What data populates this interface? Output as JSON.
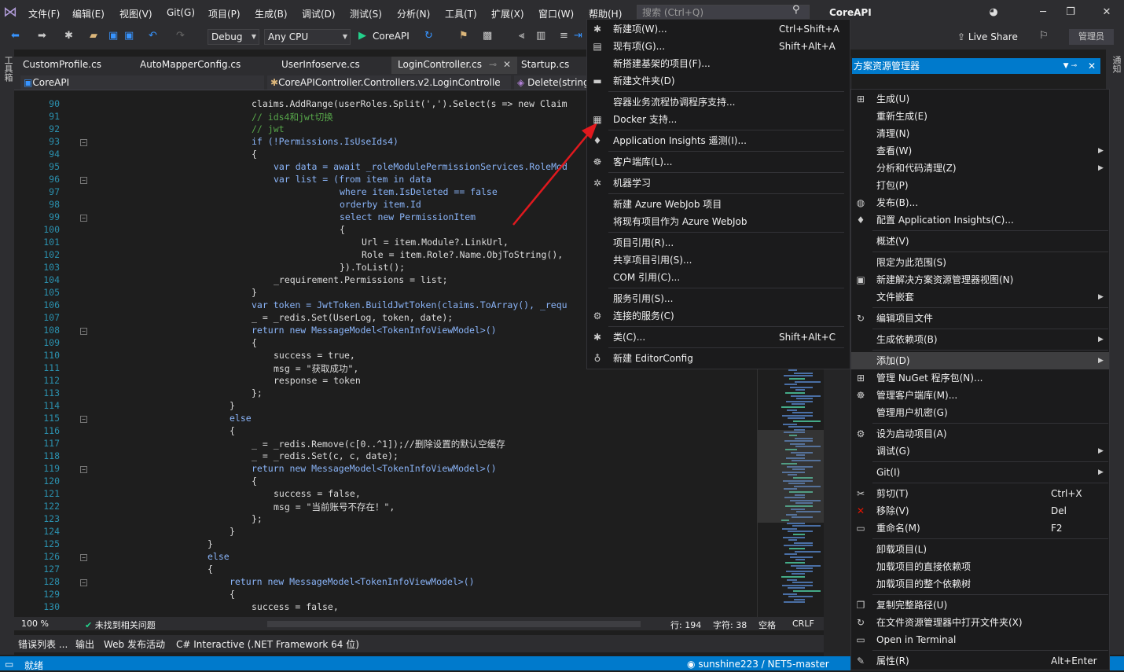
{
  "menubar": {
    "items": [
      "文件(F)",
      "编辑(E)",
      "视图(V)",
      "Git(G)",
      "项目(P)",
      "生成(B)",
      "调试(D)",
      "测试(S)",
      "分析(N)",
      "工具(T)",
      "扩展(X)",
      "窗口(W)",
      "帮助(H)"
    ],
    "search_placeholder": "搜索 (Ctrl+Q)",
    "title": "CoreAPI"
  },
  "toolbar": {
    "config": "Debug",
    "platform": "Any CPU",
    "run_target": "CoreAPI",
    "live_share": "Live Share",
    "admin": "管理员"
  },
  "tabs": [
    "CustomProfile.cs",
    "AutoMapperConfig.cs",
    "UserInfoserve.cs",
    "LoginController.cs",
    "Startup.cs"
  ],
  "nav": {
    "project": "CoreAPI",
    "class": "CoreAPIController.Controllers.v2.LoginControlle",
    "method": "Delete(string"
  },
  "left_tool": "工具箱",
  "right_tool": "通知",
  "code_lines": [
    {
      "n": "90",
      "indent": 320,
      "t": "claims.AddRange(userRoles.Split(',').Select(s => new Claim"
    },
    {
      "n": "91",
      "indent": 320,
      "t": "// ids4和jwt切换",
      "c": "cm"
    },
    {
      "n": "92",
      "indent": 320,
      "t": "// jwt",
      "c": "cm"
    },
    {
      "n": "93",
      "indent": 320,
      "t": "if (!Permissions.IsUseIds4)",
      "fold": true
    },
    {
      "n": "94",
      "indent": 320,
      "t": "{"
    },
    {
      "n": "95",
      "indent": 348,
      "t": "var data = await _roleModulePermissionServices.RoleMod"
    },
    {
      "n": "96",
      "indent": 348,
      "t": "var list = (from item in data",
      "fold": true
    },
    {
      "n": "97",
      "indent": 432,
      "t": "where item.IsDeleted == false"
    },
    {
      "n": "98",
      "indent": 432,
      "t": "orderby item.Id"
    },
    {
      "n": "99",
      "indent": 432,
      "t": "select new PermissionItem",
      "fold": true
    },
    {
      "n": "100",
      "indent": 432,
      "t": "{"
    },
    {
      "n": "101",
      "indent": 460,
      "t": "Url = item.Module?.LinkUrl,"
    },
    {
      "n": "102",
      "indent": 460,
      "t": "Role = item.Role?.Name.ObjToString(),"
    },
    {
      "n": "103",
      "indent": 432,
      "t": "}).ToList();"
    },
    {
      "n": "104",
      "indent": 348,
      "t": "_requirement.Permissions = list;"
    },
    {
      "n": "105",
      "indent": 320,
      "t": "}"
    },
    {
      "n": "106",
      "indent": 320,
      "t": "var token = JwtToken.BuildJwtToken(claims.ToArray(), _requ"
    },
    {
      "n": "107",
      "indent": 320,
      "t": "_ = _redis.Set(UserLog, token, date);"
    },
    {
      "n": "108",
      "indent": 320,
      "t": "return new MessageModel<TokenInfoViewModel>()",
      "fold": true
    },
    {
      "n": "109",
      "indent": 320,
      "t": "{"
    },
    {
      "n": "110",
      "indent": 348,
      "t": "success = true,"
    },
    {
      "n": "111",
      "indent": 348,
      "t": "msg = \"获取成功\","
    },
    {
      "n": "112",
      "indent": 348,
      "t": "response = token"
    },
    {
      "n": "113",
      "indent": 320,
      "t": "};"
    },
    {
      "n": "114",
      "indent": 292,
      "t": "}"
    },
    {
      "n": "115",
      "indent": 292,
      "t": "else",
      "fold": true
    },
    {
      "n": "116",
      "indent": 292,
      "t": "{"
    },
    {
      "n": "117",
      "indent": 320,
      "t": "_ = _redis.Remove(c[0..^1]);//删除设置的默认空缓存"
    },
    {
      "n": "118",
      "indent": 320,
      "t": "_ = _redis.Set(c, c, date);"
    },
    {
      "n": "119",
      "indent": 320,
      "t": "return new MessageModel<TokenInfoViewModel>()",
      "fold": true
    },
    {
      "n": "120",
      "indent": 320,
      "t": "{"
    },
    {
      "n": "121",
      "indent": 348,
      "t": "success = false,"
    },
    {
      "n": "122",
      "indent": 348,
      "t": "msg = \"当前账号不存在！\","
    },
    {
      "n": "123",
      "indent": 320,
      "t": "};"
    },
    {
      "n": "124",
      "indent": 292,
      "t": "}"
    },
    {
      "n": "125",
      "indent": 264,
      "t": "}"
    },
    {
      "n": "126",
      "indent": 264,
      "t": "else",
      "fold": true
    },
    {
      "n": "127",
      "indent": 264,
      "t": "{"
    },
    {
      "n": "128",
      "indent": 292,
      "t": "return new MessageModel<TokenInfoViewModel>()",
      "fold": true
    },
    {
      "n": "129",
      "indent": 292,
      "t": "{"
    },
    {
      "n": "130",
      "indent": 320,
      "t": "success = false,"
    }
  ],
  "editor_status": {
    "zoom": "100 %",
    "issues": "未找到相关问题",
    "line": "行: 194",
    "char": "字符: 38",
    "space": "空格",
    "eol": "CRLF"
  },
  "bottom_tabs": [
    "错误列表 ...",
    "输出",
    "Web 发布活动",
    "C# Interactive (.NET Framework 64 位)"
  ],
  "statusbar": {
    "ready": "就绪",
    "branch": "sunshine223 / NET5-master"
  },
  "solution_explorer": {
    "title": "方案资源管理器"
  },
  "add_menu": [
    {
      "label": "新建项(W)...",
      "shortcut": "Ctrl+Shift+A",
      "icon": "new-item-icon",
      "glyph": "✱"
    },
    {
      "label": "现有项(G)...",
      "shortcut": "Shift+Alt+A",
      "icon": "existing-item-icon",
      "glyph": "▤"
    },
    {
      "label": "新搭建基架的项目(F)..."
    },
    {
      "label": "新建文件夹(D)",
      "icon": "folder-icon",
      "glyph": "▬"
    },
    {
      "sep": true
    },
    {
      "label": "容器业务流程协调程序支持..."
    },
    {
      "label": "Docker 支持...",
      "icon": "docker-icon",
      "glyph": "▦"
    },
    {
      "sep": true
    },
    {
      "label": "Application Insights 遥测(I)...",
      "icon": "insights-icon",
      "glyph": "♦"
    },
    {
      "sep": true
    },
    {
      "label": "客户端库(L)...",
      "icon": "client-library-icon",
      "glyph": "☸"
    },
    {
      "sep": true
    },
    {
      "label": "机器学习",
      "icon": "machine-learning-icon",
      "glyph": "✲"
    },
    {
      "sep": true
    },
    {
      "label": "新建 Azure WebJob 项目"
    },
    {
      "label": "将现有项目作为 Azure WebJob"
    },
    {
      "sep": true
    },
    {
      "label": "项目引用(R)..."
    },
    {
      "label": "共享项目引用(S)..."
    },
    {
      "label": "COM 引用(C)..."
    },
    {
      "sep": true
    },
    {
      "label": "服务引用(S)..."
    },
    {
      "label": "连接的服务(C)",
      "icon": "connected-service-icon",
      "glyph": "⚙"
    },
    {
      "sep": true
    },
    {
      "label": "类(C)...",
      "shortcut": "Shift+Alt+C",
      "icon": "class-icon",
      "glyph": "✱"
    },
    {
      "sep": true
    },
    {
      "label": "新建 EditorConfig",
      "icon": "editorconfig-icon",
      "glyph": "♁"
    }
  ],
  "ctx_menu": [
    {
      "label": "生成(U)",
      "icon": "build-icon",
      "glyph": "⊞"
    },
    {
      "label": "重新生成(E)"
    },
    {
      "label": "清理(N)"
    },
    {
      "label": "查看(W)",
      "sub": true
    },
    {
      "label": "分析和代码清理(Z)",
      "sub": true
    },
    {
      "label": "打包(P)"
    },
    {
      "label": "发布(B)...",
      "icon": "publish-icon",
      "glyph": "◍"
    },
    {
      "label": "配置 Application Insights(C)...",
      "icon": "insights-icon",
      "glyph": "♦"
    },
    {
      "sep": true
    },
    {
      "label": "概述(V)"
    },
    {
      "sep": true
    },
    {
      "label": "限定为此范围(S)"
    },
    {
      "label": "新建解决方案资源管理器视图(N)",
      "icon": "new-view-icon",
      "glyph": "▣"
    },
    {
      "label": "文件嵌套",
      "sub": true
    },
    {
      "sep": true
    },
    {
      "label": "编辑项目文件",
      "icon": "edit-project-icon",
      "glyph": "↻"
    },
    {
      "sep": true
    },
    {
      "label": "生成依赖项(B)",
      "sub": true
    },
    {
      "sep": true
    },
    {
      "label": "添加(D)",
      "sub": true,
      "hl": true
    },
    {
      "label": "管理 NuGet 程序包(N)...",
      "icon": "nuget-icon",
      "glyph": "⊞"
    },
    {
      "label": "管理客户端库(M)...",
      "icon": "client-library-icon",
      "glyph": "☸"
    },
    {
      "label": "管理用户机密(G)"
    },
    {
      "sep": true
    },
    {
      "label": "设为启动项目(A)",
      "icon": "gear-icon",
      "glyph": "⚙"
    },
    {
      "label": "调试(G)",
      "sub": true
    },
    {
      "sep": true
    },
    {
      "label": "Git(I)",
      "sub": true
    },
    {
      "sep": true
    },
    {
      "label": "剪切(T)",
      "shortcut": "Ctrl+X",
      "icon": "cut-icon",
      "glyph": "✂"
    },
    {
      "label": "移除(V)",
      "shortcut": "Del",
      "icon": "remove-icon",
      "glyph": "✕",
      "color": "#e51400"
    },
    {
      "label": "重命名(M)",
      "shortcut": "F2",
      "icon": "rename-icon",
      "glyph": "▭"
    },
    {
      "sep": true
    },
    {
      "label": "卸载项目(L)"
    },
    {
      "label": "加载项目的直接依赖项"
    },
    {
      "label": "加载项目的整个依赖树"
    },
    {
      "sep": true
    },
    {
      "label": "复制完整路径(U)",
      "icon": "copy-path-icon",
      "glyph": "❐"
    },
    {
      "label": "在文件资源管理器中打开文件夹(X)",
      "icon": "open-folder-icon",
      "glyph": "↻"
    },
    {
      "label": "Open in Terminal",
      "icon": "terminal-icon",
      "glyph": "▭"
    },
    {
      "sep": true
    },
    {
      "label": "属性(R)",
      "shortcut": "Alt+Enter",
      "icon": "wrench-icon",
      "glyph": "✎"
    }
  ],
  "colors": {
    "accent": "#007acc",
    "menu_bg": "#1b1b1c",
    "editor_bg": "#1e1e1e",
    "arrow": "#e0191e"
  }
}
